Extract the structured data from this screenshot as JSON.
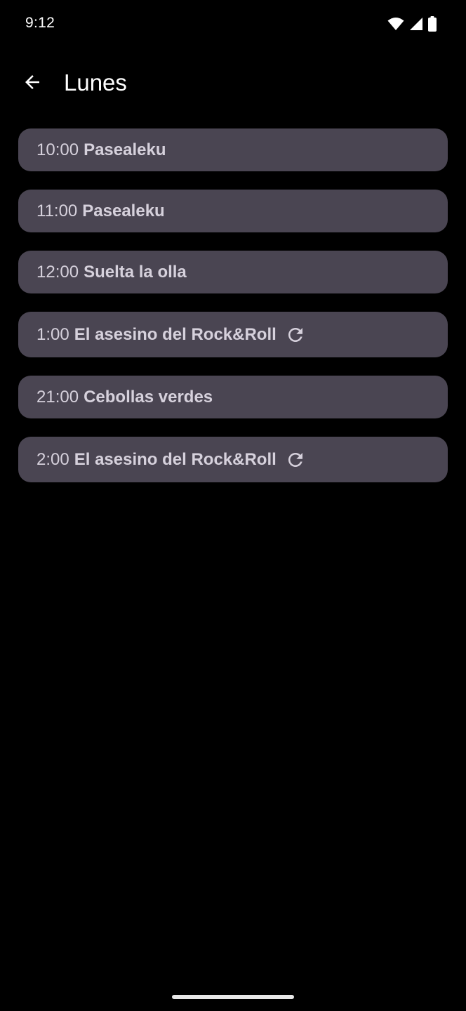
{
  "status_bar": {
    "time": "9:12",
    "icons": [
      "wifi-icon",
      "cell-signal-icon",
      "battery-icon"
    ]
  },
  "app_bar": {
    "back_icon": "arrow-back-icon",
    "title": "Lunes"
  },
  "schedule": [
    {
      "time": "10:00",
      "title": "Pasealeku",
      "repeat": false
    },
    {
      "time": "11:00",
      "title": "Pasealeku",
      "repeat": false
    },
    {
      "time": "12:00",
      "title": "Suelta la olla",
      "repeat": false
    },
    {
      "time": "1:00",
      "title": "El asesino del Rock&Roll",
      "repeat": true
    },
    {
      "time": "21:00",
      "title": "Cebollas verdes",
      "repeat": false
    },
    {
      "time": "2:00",
      "title": "El asesino del Rock&Roll",
      "repeat": true
    }
  ],
  "colors": {
    "background": "#000000",
    "card": "#4a4552",
    "card_text": "#d6d1dc"
  }
}
